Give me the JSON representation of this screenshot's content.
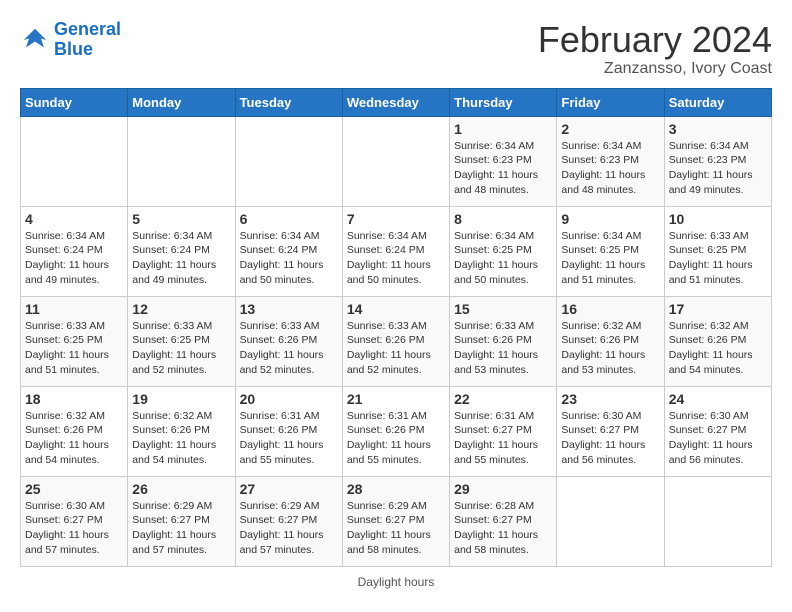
{
  "header": {
    "logo_line1": "General",
    "logo_line2": "Blue",
    "title": "February 2024",
    "subtitle": "Zanzansso, Ivory Coast"
  },
  "weekdays": [
    "Sunday",
    "Monday",
    "Tuesday",
    "Wednesday",
    "Thursday",
    "Friday",
    "Saturday"
  ],
  "weeks": [
    [
      {
        "day": "",
        "info": ""
      },
      {
        "day": "",
        "info": ""
      },
      {
        "day": "",
        "info": ""
      },
      {
        "day": "",
        "info": ""
      },
      {
        "day": "1",
        "info": "Sunrise: 6:34 AM\nSunset: 6:23 PM\nDaylight: 11 hours\nand 48 minutes."
      },
      {
        "day": "2",
        "info": "Sunrise: 6:34 AM\nSunset: 6:23 PM\nDaylight: 11 hours\nand 48 minutes."
      },
      {
        "day": "3",
        "info": "Sunrise: 6:34 AM\nSunset: 6:23 PM\nDaylight: 11 hours\nand 49 minutes."
      }
    ],
    [
      {
        "day": "4",
        "info": "Sunrise: 6:34 AM\nSunset: 6:24 PM\nDaylight: 11 hours\nand 49 minutes."
      },
      {
        "day": "5",
        "info": "Sunrise: 6:34 AM\nSunset: 6:24 PM\nDaylight: 11 hours\nand 49 minutes."
      },
      {
        "day": "6",
        "info": "Sunrise: 6:34 AM\nSunset: 6:24 PM\nDaylight: 11 hours\nand 50 minutes."
      },
      {
        "day": "7",
        "info": "Sunrise: 6:34 AM\nSunset: 6:24 PM\nDaylight: 11 hours\nand 50 minutes."
      },
      {
        "day": "8",
        "info": "Sunrise: 6:34 AM\nSunset: 6:25 PM\nDaylight: 11 hours\nand 50 minutes."
      },
      {
        "day": "9",
        "info": "Sunrise: 6:34 AM\nSunset: 6:25 PM\nDaylight: 11 hours\nand 51 minutes."
      },
      {
        "day": "10",
        "info": "Sunrise: 6:33 AM\nSunset: 6:25 PM\nDaylight: 11 hours\nand 51 minutes."
      }
    ],
    [
      {
        "day": "11",
        "info": "Sunrise: 6:33 AM\nSunset: 6:25 PM\nDaylight: 11 hours\nand 51 minutes."
      },
      {
        "day": "12",
        "info": "Sunrise: 6:33 AM\nSunset: 6:25 PM\nDaylight: 11 hours\nand 52 minutes."
      },
      {
        "day": "13",
        "info": "Sunrise: 6:33 AM\nSunset: 6:26 PM\nDaylight: 11 hours\nand 52 minutes."
      },
      {
        "day": "14",
        "info": "Sunrise: 6:33 AM\nSunset: 6:26 PM\nDaylight: 11 hours\nand 52 minutes."
      },
      {
        "day": "15",
        "info": "Sunrise: 6:33 AM\nSunset: 6:26 PM\nDaylight: 11 hours\nand 53 minutes."
      },
      {
        "day": "16",
        "info": "Sunrise: 6:32 AM\nSunset: 6:26 PM\nDaylight: 11 hours\nand 53 minutes."
      },
      {
        "day": "17",
        "info": "Sunrise: 6:32 AM\nSunset: 6:26 PM\nDaylight: 11 hours\nand 54 minutes."
      }
    ],
    [
      {
        "day": "18",
        "info": "Sunrise: 6:32 AM\nSunset: 6:26 PM\nDaylight: 11 hours\nand 54 minutes."
      },
      {
        "day": "19",
        "info": "Sunrise: 6:32 AM\nSunset: 6:26 PM\nDaylight: 11 hours\nand 54 minutes."
      },
      {
        "day": "20",
        "info": "Sunrise: 6:31 AM\nSunset: 6:26 PM\nDaylight: 11 hours\nand 55 minutes."
      },
      {
        "day": "21",
        "info": "Sunrise: 6:31 AM\nSunset: 6:26 PM\nDaylight: 11 hours\nand 55 minutes."
      },
      {
        "day": "22",
        "info": "Sunrise: 6:31 AM\nSunset: 6:27 PM\nDaylight: 11 hours\nand 55 minutes."
      },
      {
        "day": "23",
        "info": "Sunrise: 6:30 AM\nSunset: 6:27 PM\nDaylight: 11 hours\nand 56 minutes."
      },
      {
        "day": "24",
        "info": "Sunrise: 6:30 AM\nSunset: 6:27 PM\nDaylight: 11 hours\nand 56 minutes."
      }
    ],
    [
      {
        "day": "25",
        "info": "Sunrise: 6:30 AM\nSunset: 6:27 PM\nDaylight: 11 hours\nand 57 minutes."
      },
      {
        "day": "26",
        "info": "Sunrise: 6:29 AM\nSunset: 6:27 PM\nDaylight: 11 hours\nand 57 minutes."
      },
      {
        "day": "27",
        "info": "Sunrise: 6:29 AM\nSunset: 6:27 PM\nDaylight: 11 hours\nand 57 minutes."
      },
      {
        "day": "28",
        "info": "Sunrise: 6:29 AM\nSunset: 6:27 PM\nDaylight: 11 hours\nand 58 minutes."
      },
      {
        "day": "29",
        "info": "Sunrise: 6:28 AM\nSunset: 6:27 PM\nDaylight: 11 hours\nand 58 minutes."
      },
      {
        "day": "",
        "info": ""
      },
      {
        "day": "",
        "info": ""
      }
    ]
  ],
  "legend": {
    "daylight_label": "Daylight hours"
  }
}
